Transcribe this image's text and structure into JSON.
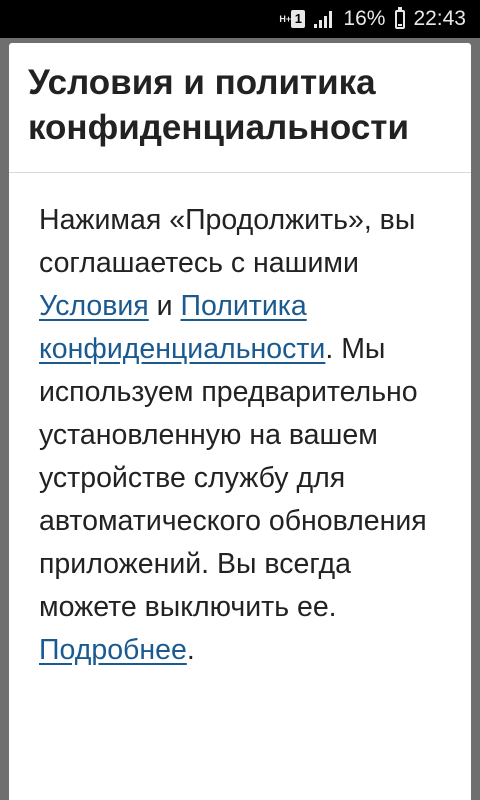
{
  "status_bar": {
    "network_type": "H+",
    "sim_slot": "1",
    "battery_percent": "16%",
    "battery_level": 0.16,
    "time": "22:43"
  },
  "dialog": {
    "title": "Условия и политика конфиденциальности",
    "body": {
      "text_1": "Нажимая «Продолжить», вы соглашаетесь с нашими ",
      "terms_link": "Условия",
      "text_2": " и ",
      "privacy_link": "Политика конфиденциальности",
      "text_3": ". Мы используем предварительно установленную на вашем устройстве службу для автоматического обновления приложений. Вы всегда можете выключить ее. ",
      "more_link": "Подробнее",
      "text_4": "."
    }
  },
  "colors": {
    "link": "#1a5a91",
    "text": "#222222",
    "status_bar_bg": "#000000",
    "backdrop": "#6f6f6f"
  }
}
